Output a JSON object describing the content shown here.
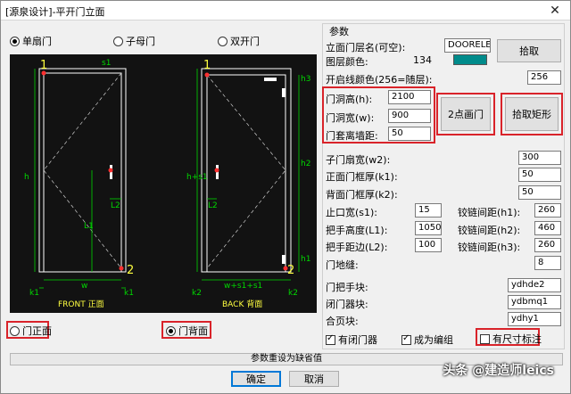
{
  "window": {
    "title": "[源泉设计]-平开门立面",
    "close_glyph": "✕"
  },
  "door_type": {
    "single": "单扇门",
    "mother_child": "子母门",
    "double": "双开门",
    "selected": "single"
  },
  "canvas": {
    "num1_left": "1",
    "num2_left": "2",
    "num1_right": "1",
    "num2_right": "2",
    "front_label": "FRONT 正面",
    "back_label": "BACK 背面",
    "dim_s1": "s1",
    "dim_h": "h",
    "dim_h1": "h1",
    "dim_l2": "L2",
    "dim_L1": "L1",
    "dim_w": "w",
    "dim_k1": "k1",
    "dim_k1b": "k1",
    "dim_h3": "h3",
    "dim_h2": "h2",
    "dim_hs1": "h+s1",
    "dim_k2": "k2",
    "dim_k2b": "k2",
    "dim_ws1s1": "w+s1+s1",
    "dim_l2b": "L2",
    "colors": {
      "bg": "#121212",
      "frame": "#ffffff",
      "dim": "#00d800",
      "yellow": "#ffff40",
      "red": "#ff3030"
    }
  },
  "view": {
    "front": "门正面",
    "back": "门背面",
    "selected": "back"
  },
  "params": {
    "group_title": "参数",
    "layer_label": "立面门层名(可空):",
    "layer_value": "DOORELEV",
    "pick_button": "拾取",
    "layer_color_label": "图层颜色:",
    "layer_color_value": "134",
    "layer_color_hex": "#008b8b",
    "open_line_color_label": "开启线颜色(256=随层):",
    "open_line_color_value": "256",
    "door_height_label": "门洞高(h):",
    "door_height_value": "2100",
    "door_width_label": "门洞宽(w):",
    "door_width_value": "900",
    "sleeve_label": "门套离墙距:",
    "sleeve_value": "50",
    "two_point_button": "2点画门",
    "pick_rect_button": "拾取矩形",
    "child_width_label": "子门扇宽(w2):",
    "child_width_value": "300",
    "front_frame_label": "正面门框厚(k1):",
    "front_frame_value": "50",
    "back_frame_label": "背面门框厚(k2):",
    "back_frame_value": "50",
    "stop_width_label": "止口宽(s1):",
    "stop_width_value": "15",
    "hinge1_label": "铰链间距(h1):",
    "hinge1_value": "260",
    "handle_height_label": "把手高度(L1):",
    "handle_height_value": "1050",
    "hinge2_label": "铰链间距(h2):",
    "hinge2_value": "460",
    "handle_edge_label": "把手距边(L2):",
    "handle_edge_value": "100",
    "hinge3_label": "铰链间距(h3):",
    "hinge3_value": "260",
    "floor_gap_label": "门地缝:",
    "floor_gap_value": "8",
    "handle_block_label": "门把手块:",
    "handle_block_value": "ydhde2",
    "closer_block_label": "闭门器块:",
    "closer_block_value": "ydbmq1",
    "hinge_block_label": "合页块:",
    "hinge_block_value": "ydhy1",
    "has_closer_label": "有闭门器",
    "as_group_label": "成为编组",
    "dim_label": "有尺寸标注"
  },
  "footer": {
    "reset": "参数重设为缺省值",
    "ok": "确定",
    "cancel": "取消"
  },
  "watermark": "头条 @建造师leics"
}
